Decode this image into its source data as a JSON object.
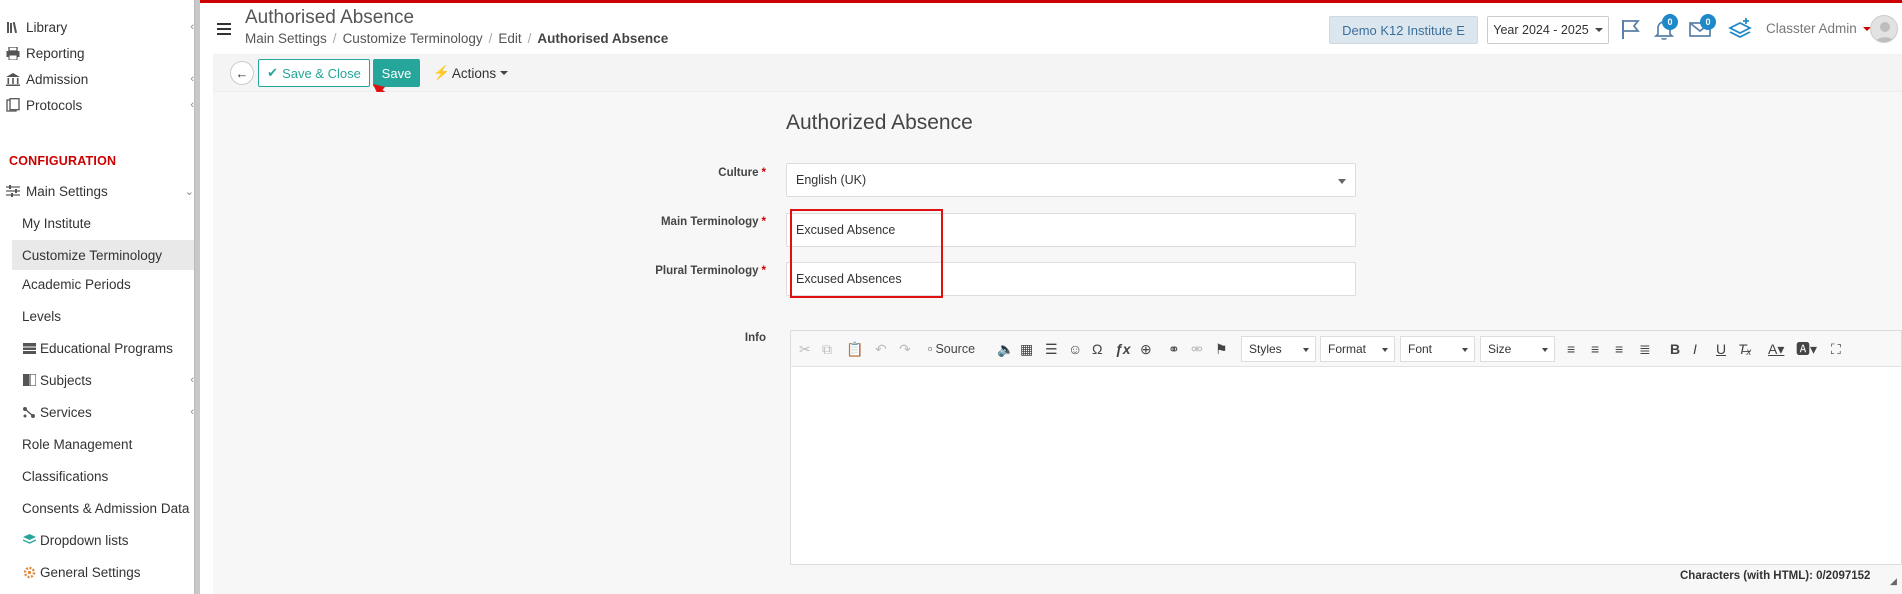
{
  "sidebar": {
    "items": [
      {
        "label": "Library",
        "icon": "books-icon"
      },
      {
        "label": "Reporting",
        "icon": "printer-icon"
      },
      {
        "label": "Admission",
        "icon": "bank-icon"
      },
      {
        "label": "Protocols",
        "icon": "document-stack-icon"
      }
    ],
    "section_heading": "CONFIGURATION",
    "main_settings": "Main Settings",
    "sub_items": [
      {
        "label": "My Institute"
      },
      {
        "label": "Customize Terminology",
        "active": true
      },
      {
        "label": "Academic Periods"
      },
      {
        "label": "Levels"
      },
      {
        "label": "Educational Programs",
        "icon": "table-icon"
      },
      {
        "label": "Subjects",
        "icon": "book-icon"
      },
      {
        "label": "Services",
        "icon": "network-icon"
      },
      {
        "label": "Role Management"
      },
      {
        "label": "Classifications"
      },
      {
        "label": "Consents & Admission Data"
      },
      {
        "label": "Dropdown lists",
        "icon": "layers-icon"
      },
      {
        "label": "General Settings",
        "icon": "gear-icon"
      }
    ]
  },
  "header": {
    "title": "Authorised Absence",
    "breadcrumbs": [
      "Main Settings",
      "Customize Terminology",
      "Edit",
      "Authorised Absence"
    ],
    "institute": "Demo K12 Institute E",
    "year": "Year 2024 - 2025",
    "notifications_count": "0",
    "messages_count": "0",
    "user": "Classter Admin"
  },
  "toolbar": {
    "save_close_label": "Save & Close",
    "save_label": "Save",
    "actions_label": "Actions"
  },
  "form": {
    "title": "Authorized Absence",
    "culture_label": "Culture",
    "culture_value": "English (UK)",
    "main_label": "Main Terminology",
    "main_value": "Excused Absence",
    "plural_label": "Plural Terminology",
    "plural_value": "Excused Absences",
    "info_label": "Info"
  },
  "editor": {
    "source_label": "Source",
    "styles_label": "Styles",
    "format_label": "Format",
    "font_label": "Font",
    "size_label": "Size",
    "chars_label": "Characters (with HTML): 0/2097152"
  },
  "colors": {
    "accent": "#26a69a",
    "danger": "#cc0000",
    "highlight": "#e01010",
    "institute_bg": "#dce6ef"
  }
}
